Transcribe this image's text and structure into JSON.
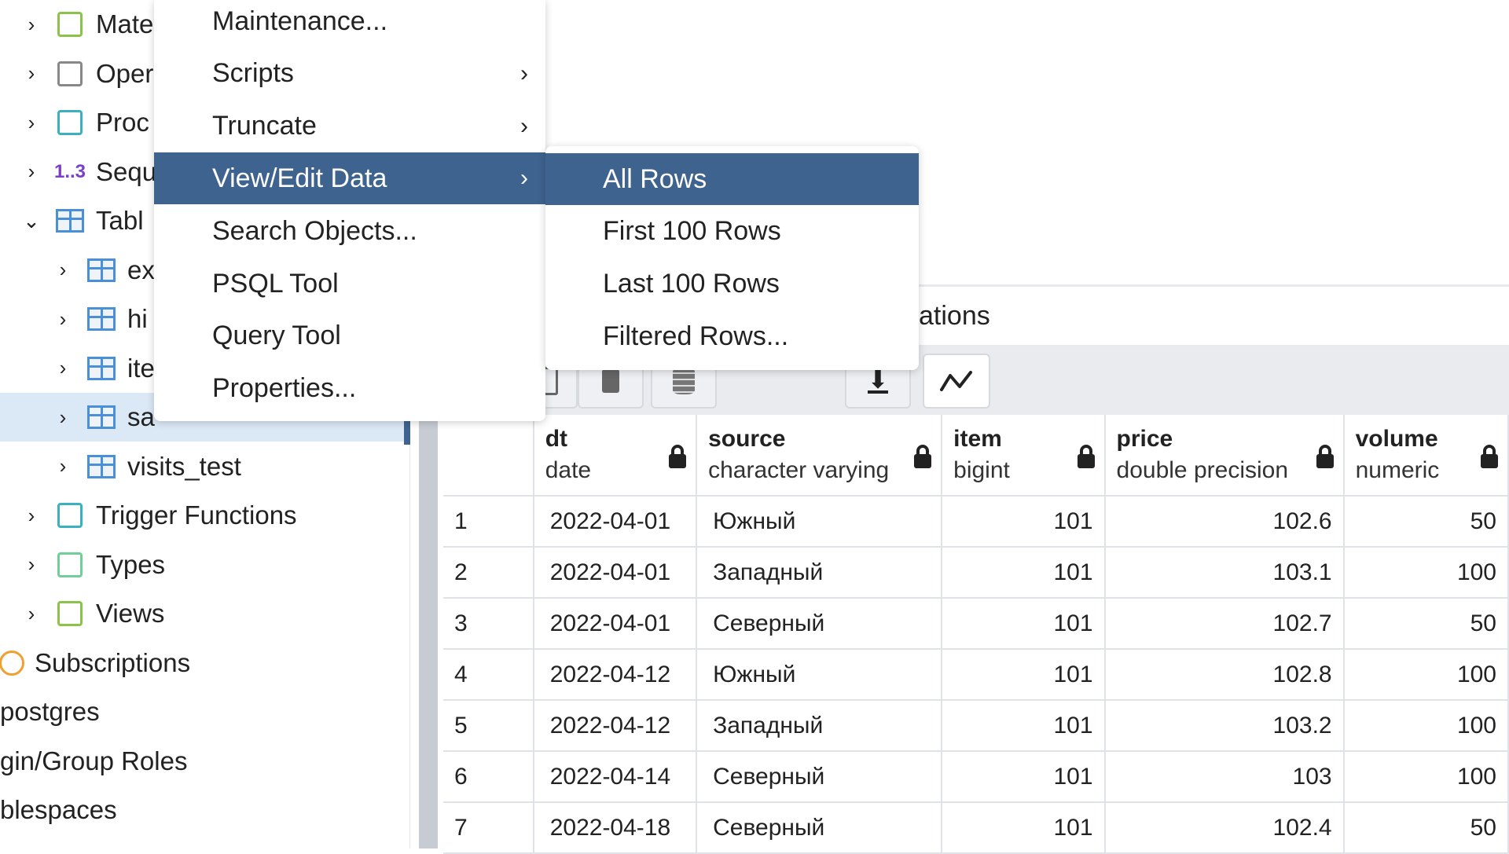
{
  "tree": [
    {
      "label": "Mate",
      "icon": "materialized-view-icon",
      "chev": "›",
      "indent": 0
    },
    {
      "label": "Oper",
      "icon": "operator-icon",
      "chev": "›",
      "indent": 0
    },
    {
      "label": "Proc",
      "icon": "procedure-icon",
      "chev": "›",
      "indent": 0
    },
    {
      "label": "Sequ",
      "icon": "sequence-icon",
      "icon_text": "1..3",
      "chev": "›",
      "indent": 0
    },
    {
      "label": "Tabl",
      "icon": "tables-icon",
      "chev": "⌄",
      "indent": 0
    },
    {
      "label": "ex",
      "icon": "table-icon",
      "chev": "›",
      "indent": 1
    },
    {
      "label": "hi",
      "icon": "table-icon",
      "chev": "›",
      "indent": 1
    },
    {
      "label": "ite",
      "icon": "table-icon",
      "chev": "›",
      "indent": 1
    },
    {
      "label": "sa",
      "icon": "table-icon",
      "chev": "›",
      "indent": 1,
      "selected": true
    },
    {
      "label": "visits_test",
      "icon": "table-icon",
      "chev": "›",
      "indent": 1
    },
    {
      "label": "Trigger Functions",
      "icon": "trigger-function-icon",
      "chev": "›",
      "indent": 0
    },
    {
      "label": "Types",
      "icon": "type-icon",
      "chev": "›",
      "indent": 0
    },
    {
      "label": "Views",
      "icon": "view-icon",
      "chev": "›",
      "indent": 0
    },
    {
      "label": "Subscriptions",
      "icon": "subscription-icon",
      "indent": -1
    },
    {
      "label": "postgres",
      "indent": -2
    },
    {
      "label": "gin/Group Roles",
      "indent": -2
    },
    {
      "label": "blespaces",
      "indent": -2
    }
  ],
  "tab_fragment": "ations",
  "context_menu": [
    {
      "label": "Maintenance..."
    },
    {
      "label": "Scripts",
      "submenu": true
    },
    {
      "label": "Truncate",
      "submenu": true
    },
    {
      "label": "View/Edit Data",
      "submenu": true,
      "highlighted": true
    },
    {
      "label": "Search Objects..."
    },
    {
      "label": "PSQL Tool"
    },
    {
      "label": "Query Tool"
    },
    {
      "label": "Properties..."
    }
  ],
  "submenu": [
    {
      "label": "All Rows",
      "highlighted": true
    },
    {
      "label": "First 100 Rows"
    },
    {
      "label": "Last 100 Rows"
    },
    {
      "label": "Filtered Rows..."
    }
  ],
  "arrow_glyph": "›",
  "toolbar": [
    {
      "icon": "file-icon"
    },
    {
      "icon": "chevron-down-icon",
      "glyph": "⌄"
    },
    {
      "icon": "copy-icon"
    },
    {
      "icon": "paste-icon"
    },
    {
      "icon": "save-data-icon"
    },
    {
      "icon": "download-icon"
    },
    {
      "icon": "graph-icon"
    }
  ],
  "grid": {
    "columns": [
      {
        "name": "dt",
        "type": "date"
      },
      {
        "name": "source",
        "type": "character varying"
      },
      {
        "name": "item",
        "type": "bigint"
      },
      {
        "name": "price",
        "type": "double precision"
      },
      {
        "name": "volume",
        "type": "numeric"
      }
    ],
    "rows": [
      [
        "1",
        "2022-04-01",
        "Южный",
        "101",
        "102.6",
        "50"
      ],
      [
        "2",
        "2022-04-01",
        "Западный",
        "101",
        "103.1",
        "100"
      ],
      [
        "3",
        "2022-04-01",
        "Северный",
        "101",
        "102.7",
        "50"
      ],
      [
        "4",
        "2022-04-12",
        "Южный",
        "101",
        "102.8",
        "100"
      ],
      [
        "5",
        "2022-04-12",
        "Западный",
        "101",
        "103.2",
        "100"
      ],
      [
        "6",
        "2022-04-14",
        "Северный",
        "101",
        "103",
        "100"
      ],
      [
        "7",
        "2022-04-18",
        "Северный",
        "101",
        "102.4",
        "50"
      ]
    ]
  },
  "colors": {
    "accent": "#3f638f",
    "selected_row": "#dbe8f5"
  }
}
